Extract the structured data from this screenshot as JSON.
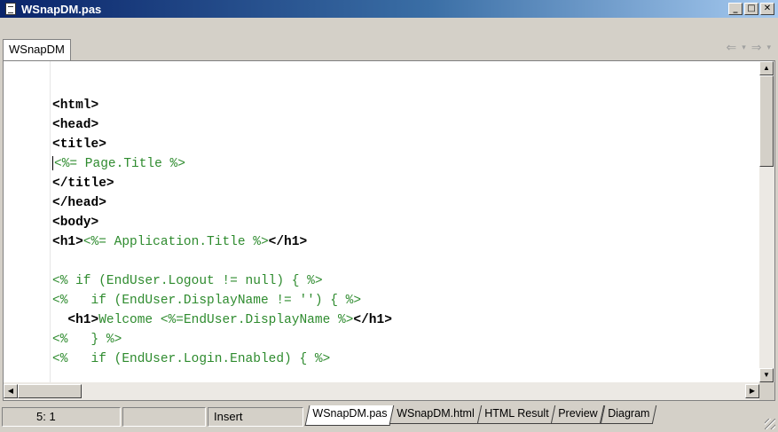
{
  "window": {
    "title": "WSnapDM.pas"
  },
  "title_buttons": {
    "minimize": "_",
    "maximize": "□",
    "close": "✕"
  },
  "tabs": {
    "top_tab": "WSnapDM"
  },
  "nav": {
    "back": "⇐",
    "dropdown1": "▾",
    "forward": "⇒",
    "dropdown2": "▾"
  },
  "editor": {
    "lines": [
      "",
      "<html>",
      "<head>",
      "<title>",
      "<%= Page.Title %>",
      "</title>",
      "</head>",
      "<body>",
      "<h1><%= Application.Title %></h1>",
      "",
      "<% if (EndUser.Logout != null) { %>",
      "<%   if (EndUser.DisplayName != '') { %>",
      "  <h1>Welcome <%=EndUser.DisplayName %></h1>",
      "<%   } %>",
      "<%   if (EndUser.Login.Enabled) { %>"
    ]
  },
  "statusbar": {
    "position": "5:  1",
    "mode": "Insert",
    "tabs": [
      "WSnapDM.pas",
      "WSnapDM.html",
      "HTML Result",
      "Preview",
      "Diagram"
    ],
    "active_tab": "WSnapDM.pas"
  },
  "colors": {
    "tag": "#000000",
    "script": "#2e8b2e",
    "titlebar": "#0a246a"
  }
}
